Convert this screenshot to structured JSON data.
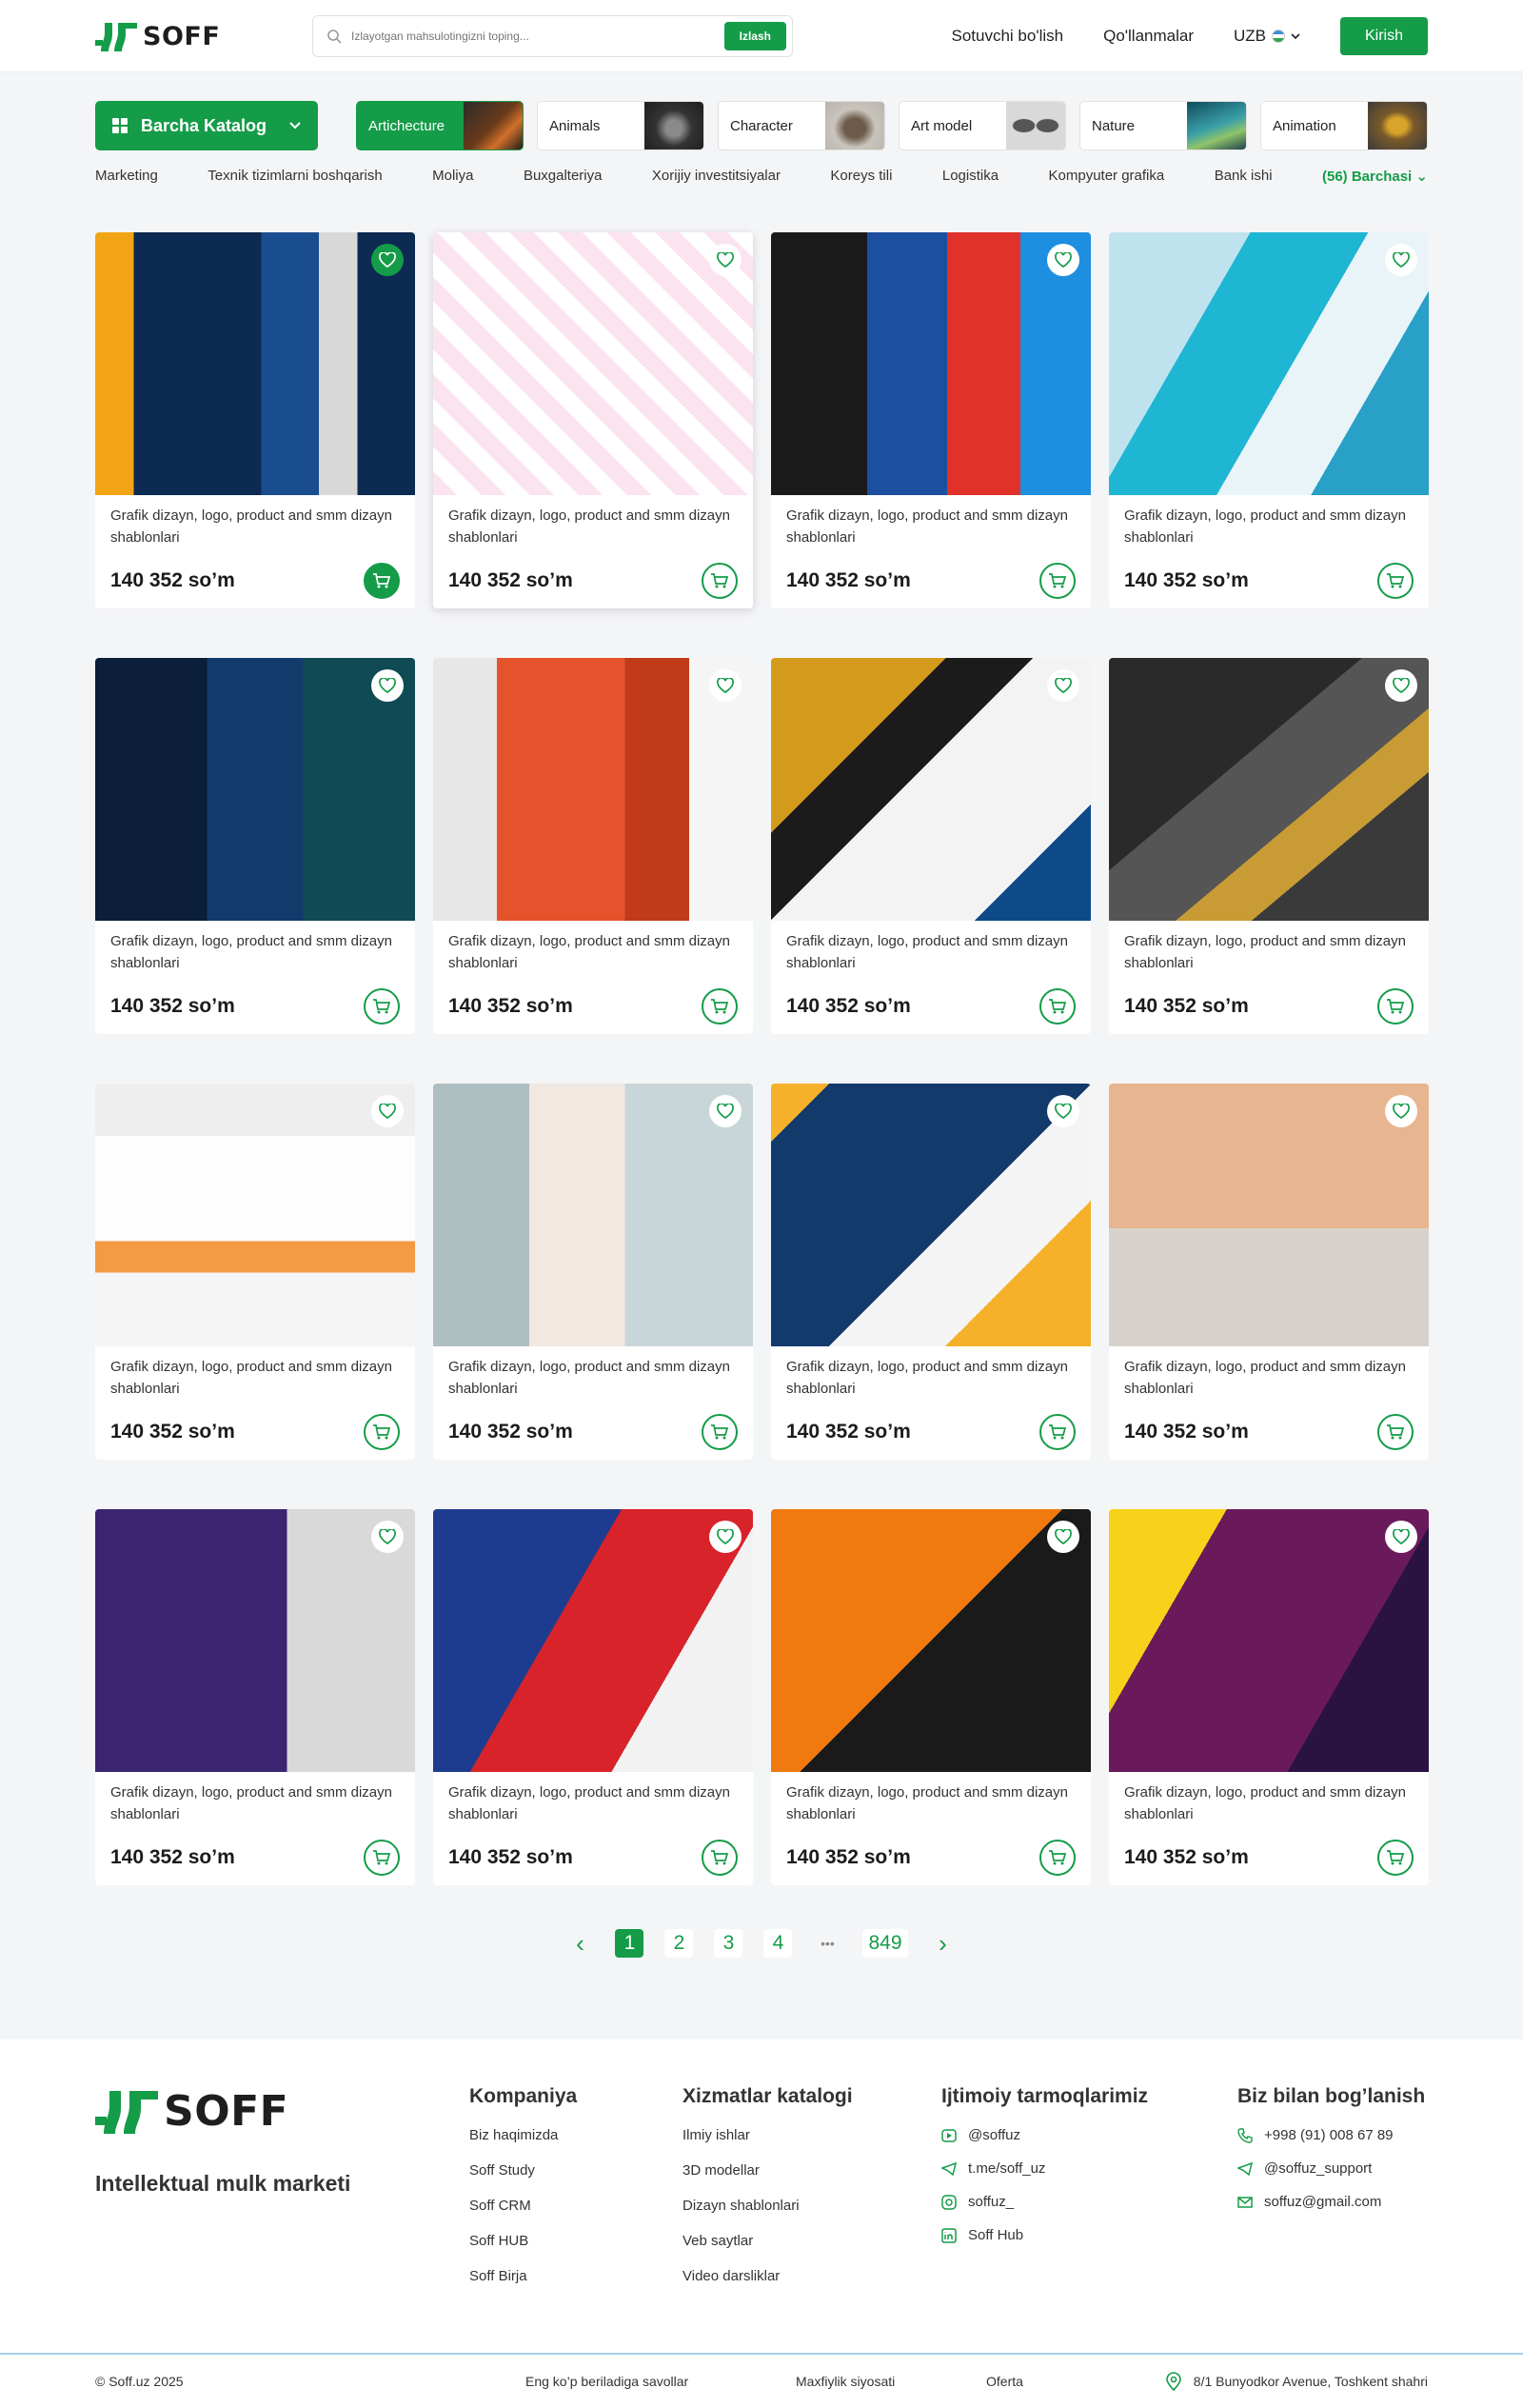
{
  "header": {
    "brand": "SOFF",
    "search_placeholder": "Izlayotgan mahsulotingizni toping...",
    "search_button": "Izlash",
    "nav": [
      "Sotuvchi bo'lish",
      "Qo'llanmalar"
    ],
    "lang": "UZB",
    "login": "Kirish"
  },
  "catalog": {
    "button": "Barcha Katalog",
    "chips": [
      "Artichecture",
      "Animals",
      "Character",
      "Art model",
      "Nature",
      "Animation"
    ],
    "subcats": [
      "Marketing",
      "Texnik tizimlarni boshqarish",
      "Moliya",
      "Buxgalteriya",
      "Xorijiy investitsiyalar",
      "Koreys tili",
      "Logistika",
      "Kompyuter grafika",
      "Bank ishi"
    ],
    "more": "(56) Barchasi"
  },
  "products": {
    "title": "Grafik dizayn, logo, product and smm dizayn shablonlari",
    "price": "140 352 so’m",
    "count": 16
  },
  "pagination": {
    "pages": [
      "1",
      "2",
      "3",
      "4",
      "•••",
      "849"
    ],
    "current": "1"
  },
  "footer": {
    "tagline": "Intellektual mulk marketi",
    "company": {
      "title": "Kompaniya",
      "links": [
        "Biz haqimizda",
        "Soff Study",
        "Soff CRM",
        "Soff HUB",
        "Soff Birja"
      ]
    },
    "services": {
      "title": "Xizmatlar katalogi",
      "links": [
        "Ilmiy ishlar",
        "3D modellar",
        "Dizayn shablonlari",
        "Veb saytlar",
        "Video darsliklar"
      ]
    },
    "social": {
      "title": "Ijtimoiy tarmoqlarimiz",
      "links": [
        "@soffuz",
        "t.me/soff_uz",
        "soffuz_",
        "Soff Hub"
      ]
    },
    "contact": {
      "title": "Biz bilan bog’lanish",
      "links": [
        "+998 (91) 008 67 89",
        "@soffuz_support",
        "soffuz@gmail.com"
      ]
    },
    "copyright": "© Soff.uz 2025",
    "faq": "Eng ko’p beriladiga savollar",
    "privacy": "Maxfiylik siyosati",
    "offer": "Oferta",
    "address": "8/1 Bunyodkor Avenue, Toshkent shahri"
  },
  "colors": {
    "accent": "#149c48",
    "bg": "#f4f5f7"
  }
}
